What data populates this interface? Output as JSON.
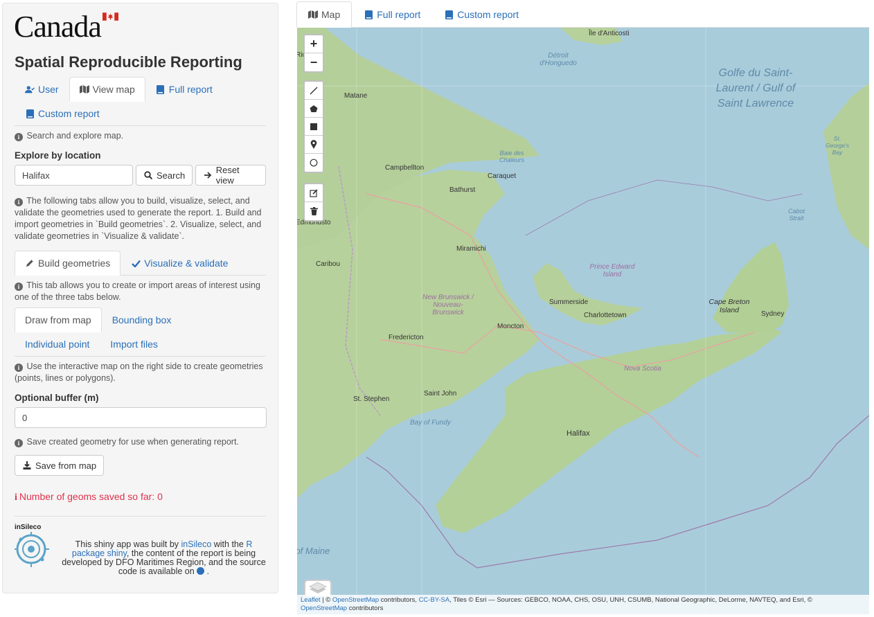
{
  "logo": {
    "text": "Canada"
  },
  "app_title": "Spatial Reproducible Reporting",
  "sidebar_tabs": [
    {
      "label": "User",
      "icon": "user-icon"
    },
    {
      "label": "View map",
      "icon": "map-icon"
    },
    {
      "label": "Full report",
      "icon": "book-icon"
    },
    {
      "label": "Custom report",
      "icon": "book-icon"
    }
  ],
  "search_info": "Search and explore map.",
  "explore": {
    "label": "Explore by location",
    "value": "Halifax",
    "search_label": "Search",
    "reset_label": "Reset view"
  },
  "tabs_info": "The following tabs allow you to build, visualize, select, and validate the geometries used to generate the report. 1. Build and import geometries in `Build geometries`. 2. Visualize, select, and validate geometries in `Visualize & validate`.",
  "geom_tabs": [
    {
      "label": "Build geometries"
    },
    {
      "label": "Visualize & validate"
    }
  ],
  "build_info": "This tab allows you to create or import areas of interest using one of the three tabs below.",
  "draw_tabs": [
    {
      "label": "Draw from map"
    },
    {
      "label": "Bounding box"
    },
    {
      "label": "Individual point"
    },
    {
      "label": "Import files"
    }
  ],
  "draw_info": "Use the interactive map on the right side to create geometries (points, lines or polygons).",
  "buffer": {
    "label": "Optional buffer (m)",
    "value": "0"
  },
  "save_info": "Save created geometry for use when generating report.",
  "save_button": "Save from map",
  "geoms_saved": "Number of geoms saved so far: 0",
  "footer": {
    "logo_text": "inSileco",
    "t1": "This shiny app was built by ",
    "link1": "inSileco",
    "t2": " with the ",
    "link2": "R package shiny",
    "t3": ", the content of the report is being developed by DFO Maritimes Region, and the source code is available on ",
    "t4": " ."
  },
  "main_tabs": [
    {
      "label": "Map",
      "icon": "map-icon"
    },
    {
      "label": "Full report",
      "icon": "book-icon"
    },
    {
      "label": "Custom report",
      "icon": "book-icon"
    }
  ],
  "map": {
    "zoom_in": "+",
    "zoom_out": "−",
    "draw_tools": [
      "polyline-icon",
      "polygon-icon",
      "rectangle-icon",
      "marker-icon",
      "circle-icon"
    ],
    "edit_tools": [
      "edit-icon",
      "trash-icon"
    ],
    "places": [
      {
        "name": "Île d'Anticosti"
      },
      {
        "name": "Matane"
      },
      {
        "name": "Campbellton"
      },
      {
        "name": "Bathurst"
      },
      {
        "name": "Caraquet"
      },
      {
        "name": "Miramichi"
      },
      {
        "name": "Caribou"
      },
      {
        "name": "Summerside"
      },
      {
        "name": "Charlottetown"
      },
      {
        "name": "Moncton"
      },
      {
        "name": "Fredericton"
      },
      {
        "name": "Saint John"
      },
      {
        "name": "St. Stephen"
      },
      {
        "name": "Halifax"
      },
      {
        "name": "Sydney"
      },
      {
        "name": "Cape Breton Island"
      },
      {
        "name": "Edmundston"
      },
      {
        "name": "Rimouski"
      }
    ],
    "water": {
      "gulf": "Golfe du Saint-Laurent / Gulf of Saint Lawrence",
      "detroit": "Détroit d'Honguedo",
      "chaleurs": "Baie des Chaleurs",
      "pei": "Prince Edward Island",
      "nb": "New Brunswick / Nouveau-Brunswick",
      "ns": "Nova Scotia",
      "fundy": "Bay of Fundy",
      "maine": "Gulf of Maine",
      "cabot": "Cabot Strait",
      "stgeorge": "St. George's Bay"
    },
    "attribution": {
      "leaflet": "Leaflet",
      "osm": "OpenStreetMap",
      "ccbysa": "CC-BY-SA",
      "rest": ", Tiles © Esri — Sources: GEBCO, NOAA, CHS, OSU, UNH, CSUMB, National Geographic, DeLorme, NAVTEQ, and Esri, ©",
      "contributors": "contributors"
    }
  }
}
